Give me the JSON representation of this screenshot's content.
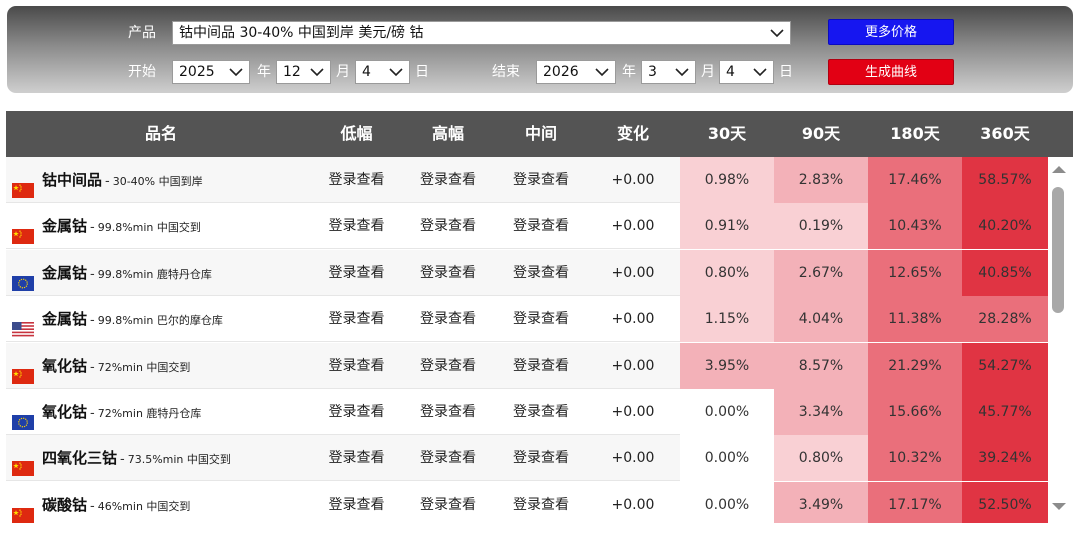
{
  "filters": {
    "product_label": "产品",
    "product_value": "钴中间品 30-40% 中国到岸 美元/磅 钴",
    "start_label": "开始",
    "start_year": "2025",
    "start_year_unit": "年",
    "start_month": "12",
    "start_month_unit": "月",
    "start_day": "4",
    "start_day_unit": "日",
    "end_label": "结束",
    "end_year": "2026",
    "end_year_unit": "年",
    "end_month": "3",
    "end_month_unit": "月",
    "end_day": "4",
    "end_day_unit": "日",
    "more_prices_button": "更多价格",
    "generate_curve_button": "生成曲线"
  },
  "table": {
    "headers": [
      "品名",
      "低幅",
      "高幅",
      "中间",
      "变化",
      "30天",
      "90天",
      "180天",
      "360天"
    ],
    "rows": [
      {
        "flag": "cn",
        "name": "钴中间品",
        "sep": "-",
        "spec": "30-40% 中国到岸",
        "low": "登录查看",
        "high": "登录查看",
        "mid": "登录查看",
        "change": "+0.00",
        "d30": "0.98%",
        "d90": "2.83%",
        "d180": "17.46%",
        "d360": "58.57%"
      },
      {
        "flag": "cn",
        "name": "金属钴",
        "sep": "-",
        "spec": "99.8%min 中国交到",
        "low": "登录查看",
        "high": "登录查看",
        "mid": "登录查看",
        "change": "+0.00",
        "d30": "0.91%",
        "d90": "0.19%",
        "d180": "10.43%",
        "d360": "40.20%"
      },
      {
        "flag": "eu",
        "name": "金属钴",
        "sep": "-",
        "spec": "99.8%min 鹿特丹仓库",
        "low": "登录查看",
        "high": "登录查看",
        "mid": "登录查看",
        "change": "+0.00",
        "d30": "0.80%",
        "d90": "2.67%",
        "d180": "12.65%",
        "d360": "40.85%"
      },
      {
        "flag": "us",
        "name": "金属钴",
        "sep": "-",
        "spec": "99.8%min 巴尔的摩仓库",
        "low": "登录查看",
        "high": "登录查看",
        "mid": "登录查看",
        "change": "+0.00",
        "d30": "1.15%",
        "d90": "4.04%",
        "d180": "11.38%",
        "d360": "28.28%"
      },
      {
        "flag": "cn",
        "name": "氧化钴",
        "sep": "-",
        "spec": "72%min 中国交到",
        "low": "登录查看",
        "high": "登录查看",
        "mid": "登录查看",
        "change": "+0.00",
        "d30": "3.95%",
        "d90": "8.57%",
        "d180": "21.29%",
        "d360": "54.27%"
      },
      {
        "flag": "eu",
        "name": "氧化钴",
        "sep": "-",
        "spec": "72%min 鹿特丹仓库",
        "low": "登录查看",
        "high": "登录查看",
        "mid": "登录查看",
        "change": "+0.00",
        "d30": "0.00%",
        "d90": "3.34%",
        "d180": "15.66%",
        "d360": "45.77%"
      },
      {
        "flag": "cn",
        "name": "四氧化三钴",
        "sep": "-",
        "spec": "73.5%min 中国交到",
        "low": "登录查看",
        "high": "登录查看",
        "mid": "登录查看",
        "change": "+0.00",
        "d30": "0.00%",
        "d90": "0.80%",
        "d180": "10.32%",
        "d360": "39.24%"
      },
      {
        "flag": "cn",
        "name": "碳酸钴",
        "sep": "-",
        "spec": "46%min 中国交到",
        "low": "登录查看",
        "high": "登录查看",
        "mid": "登录查看",
        "change": "+0.00",
        "d30": "0.00%",
        "d90": "3.49%",
        "d180": "17.17%",
        "d360": "52.50%"
      }
    ]
  },
  "colors": {
    "header_bg": "#545454",
    "btn_blue": "#1616f0",
    "btn_red": "#e20014",
    "heat_none": "#ffffff",
    "heat_1": "#f9d0d4",
    "heat_2": "#f3b1b8",
    "heat_3": "#ea6f7b",
    "heat_4": "#e03443"
  }
}
